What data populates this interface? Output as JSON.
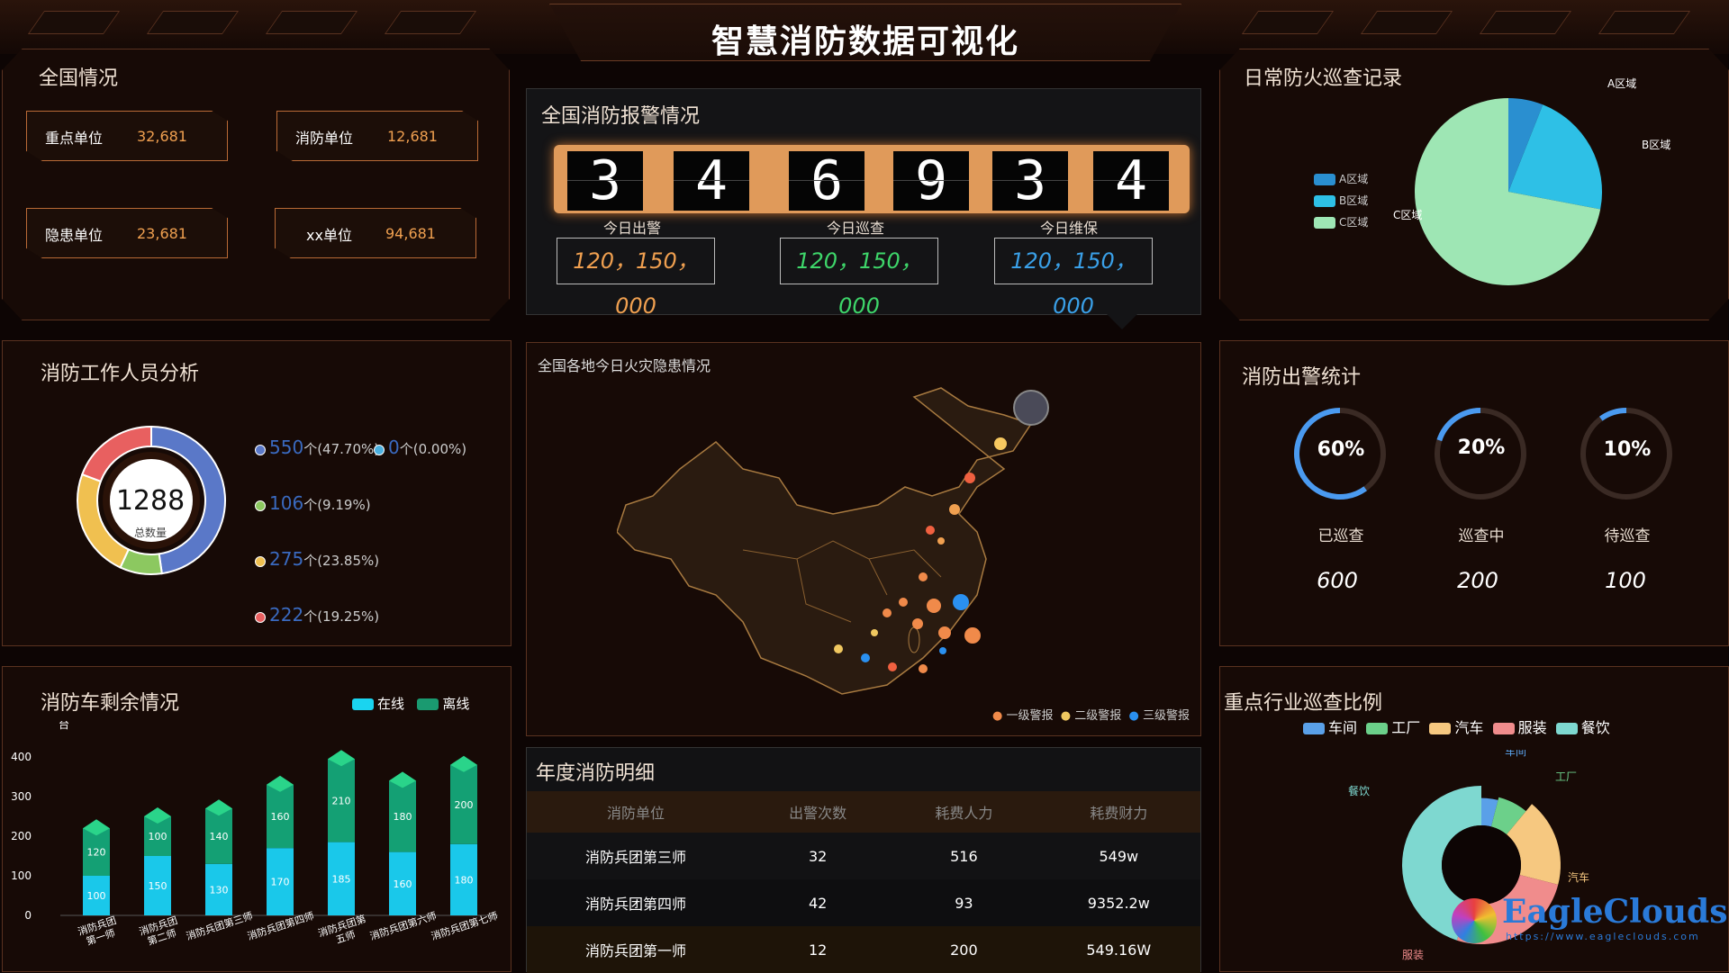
{
  "header": {
    "title": "智慧消防数据可视化"
  },
  "national": {
    "title": "全国情况",
    "cards": [
      {
        "name": "重点单位",
        "value": "32,681"
      },
      {
        "name": "消防单位",
        "value": "12,681"
      },
      {
        "name": "隐患单位",
        "value": "23,681"
      },
      {
        "name": "xx单位",
        "value": "94,681"
      }
    ]
  },
  "alarm": {
    "title": "全国消防报警情况",
    "digits": [
      "3",
      "4",
      "6",
      "9",
      "3",
      "4"
    ],
    "stats": [
      {
        "label": "今日出警",
        "value": "120，150，000",
        "color": "#f0a050"
      },
      {
        "label": "今日巡查",
        "value": "120，150，000",
        "color": "#3ed66a"
      },
      {
        "label": "今日维保",
        "value": "120，150，000",
        "color": "#3aa0e8"
      }
    ]
  },
  "patrol": {
    "title": "日常防火巡查记录",
    "legend": [
      "A区域",
      "B区域",
      "C区域"
    ],
    "labels": [
      "A区域",
      "B区域",
      "C区域"
    ],
    "chart_data": {
      "type": "pie",
      "categories": [
        "A区域",
        "B区域",
        "C区域"
      ],
      "values": [
        6,
        22,
        72
      ],
      "colors": [
        "#2a8fd0",
        "#2ec0e6",
        "#9ee6b4"
      ]
    }
  },
  "staff": {
    "title": "消防工作人员分析",
    "center_value": "1288",
    "center_label": "总数量",
    "items": [
      {
        "value": "550",
        "unit": "个",
        "pct": "(47.70%)",
        "color": "#5a78c8"
      },
      {
        "value": "0",
        "unit": "个",
        "pct": "(0.00%)",
        "color": "#4ab0e0"
      },
      {
        "value": "106",
        "unit": "个",
        "pct": "(9.19%)",
        "color": "#8cc860"
      },
      {
        "value": "275",
        "unit": "个",
        "pct": "(23.85%)",
        "color": "#f0c050"
      },
      {
        "value": "222",
        "unit": "个",
        "pct": "(19.25%)",
        "color": "#e86060"
      }
    ],
    "chart_data": {
      "type": "pie",
      "values": [
        550,
        0,
        106,
        275,
        222
      ],
      "total": 1288
    }
  },
  "map": {
    "title": "全国各地今日火灾隐患情况",
    "legend": [
      "一级警报",
      "二级警报",
      "三级警报"
    ],
    "legend_colors": [
      "#f08a4a",
      "#f0c860",
      "#2a90f0"
    ]
  },
  "dispatch": {
    "title": "消防出警统计",
    "gauges": [
      {
        "pct": "60%",
        "label": "已巡查",
        "value": "600",
        "fraction": 0.6
      },
      {
        "pct": "20%",
        "label": "巡查中",
        "value": "200",
        "fraction": 0.2
      },
      {
        "pct": "10%",
        "label": "待巡查",
        "value": "100",
        "fraction": 0.1
      }
    ]
  },
  "trucks": {
    "title": "消防车剩余情况",
    "unit": "台",
    "legend": [
      "在线",
      "离线"
    ],
    "chart_data": {
      "type": "bar",
      "categories": [
        "消防兵团\n第一师",
        "消防兵团\n第二师",
        "消防兵团第三师",
        "消防兵团第四师",
        "消防兵团第\n五师",
        "消防兵团第六师",
        "消防兵团第七师"
      ],
      "series": [
        {
          "name": "在线",
          "values": [
            100,
            150,
            130,
            170,
            185,
            160,
            180
          ]
        },
        {
          "name": "离线",
          "values": [
            120,
            100,
            140,
            160,
            210,
            180,
            200
          ]
        }
      ],
      "ylim": [
        0,
        400
      ],
      "yticks": [
        "400",
        "300",
        "200",
        "100",
        "0"
      ]
    }
  },
  "annual": {
    "title": "年度消防明细",
    "headers": [
      "消防单位",
      "出警次数",
      "耗费人力",
      "耗费财力"
    ],
    "rows": [
      [
        "消防兵团第三师",
        "32",
        "516",
        "549w"
      ],
      [
        "消防兵团第四师",
        "42",
        "93",
        "9352.2w"
      ],
      [
        "消防兵团第一师",
        "12",
        "200",
        "549.16W"
      ]
    ]
  },
  "industry": {
    "title": "重点行业巡查比例",
    "legend": [
      "车间",
      "工厂",
      "汽车",
      "服装",
      "餐饮"
    ],
    "chart_data": {
      "type": "pie",
      "categories": [
        "车间",
        "工厂",
        "汽车",
        "服装",
        "餐饮"
      ],
      "values": [
        4,
        7,
        18,
        26,
        45
      ],
      "colors": [
        "#5aa0e8",
        "#6cd08a",
        "#f6c880",
        "#f08c8c",
        "#7ed8d0"
      ]
    }
  },
  "watermark": {
    "brand": "EagleClouds",
    "url": "https://www.eagleclouds.com"
  }
}
